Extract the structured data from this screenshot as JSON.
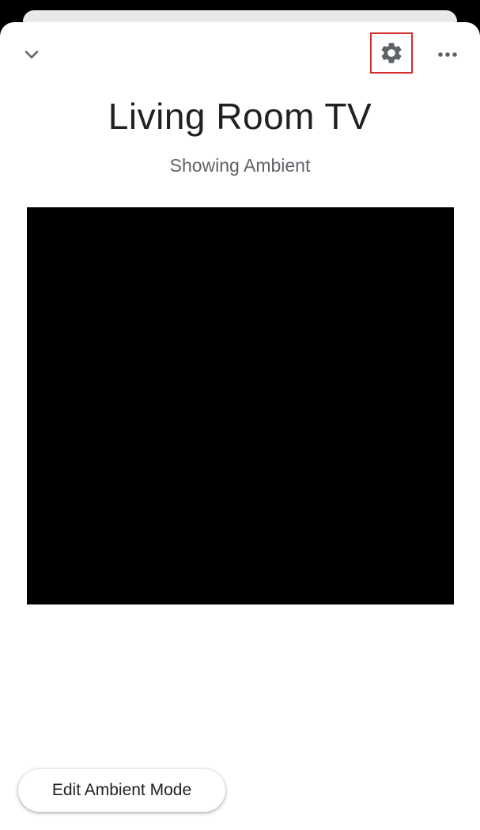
{
  "header": {
    "collapse_icon": "chevron-down-icon",
    "settings_icon": "gear-icon",
    "more_icon": "more-horizontal-icon",
    "settings_highlight_color": "#d32f2f"
  },
  "device": {
    "name": "Living Room TV",
    "status": "Showing Ambient"
  },
  "preview": {
    "background_color": "#000000"
  },
  "actions": {
    "edit_label": "Edit Ambient Mode"
  }
}
